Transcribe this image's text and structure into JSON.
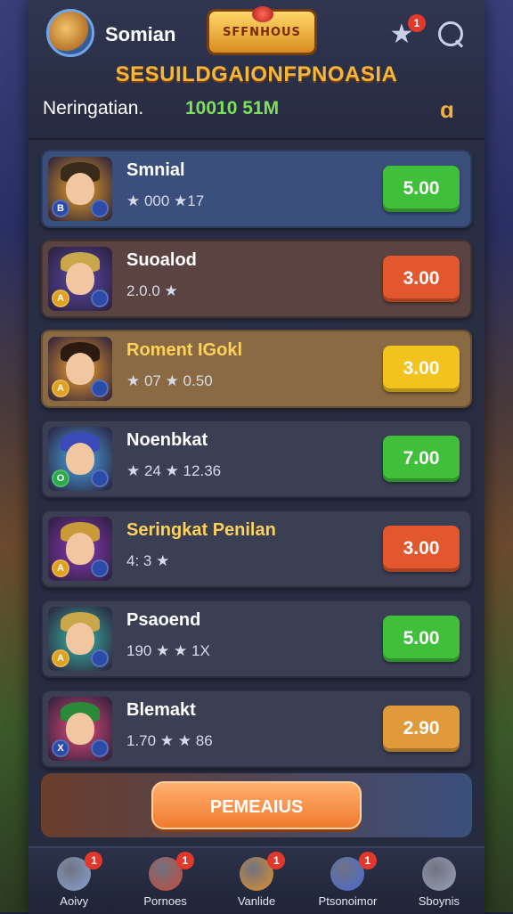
{
  "header": {
    "player_name": "Somian",
    "logo_text": "SFFNHOUS",
    "title": "SESUILDGAIONFPNOASIA",
    "notification_count": "1",
    "balance_label": "Neringatian.",
    "balance_value": "10010 51M"
  },
  "heroes": [
    {
      "name": "Smnial",
      "stats": "★ 000 ★17",
      "price": "5.00",
      "price_color": "#3fbf3a",
      "card_bg": "#3a4f7c",
      "name_color": "#ffffff",
      "hair": "#3a2a1a",
      "bg": "#e6a22a",
      "coin1": "#2c4aa8",
      "coin1_text": "B"
    },
    {
      "name": "Suoalod",
      "stats": "2.0.0 ★",
      "price": "3.00",
      "price_color": "#e2572d",
      "card_bg": "#5a4340",
      "name_color": "#ffffff",
      "hair": "#c8a84a",
      "bg": "#5a4aa8",
      "coin1": "#e0a020",
      "coin1_text": "A"
    },
    {
      "name": "Roment IGokl",
      "stats": "★ 07 ★ 0.50",
      "price": "3.00",
      "price_color": "#f2c21f",
      "card_bg": "#8a6a42",
      "name_color": "#ffd15a",
      "hair": "#2a1a10",
      "bg": "#f0a030",
      "coin1": "#e0a020",
      "coin1_text": "A"
    },
    {
      "name": "Noenbkat",
      "stats": "★ 24 ★ 12.36",
      "price": "7.00",
      "price_color": "#3fbf3a",
      "card_bg": "#3a3f54",
      "name_color": "#ffffff",
      "hair": "#3a4ab8",
      "bg": "#4aa8e8",
      "coin1": "#2aa84a",
      "coin1_text": "O"
    },
    {
      "name": "Seringkat Penilan",
      "stats": "4: 3 ★",
      "price": "3.00",
      "price_color": "#e2572d",
      "card_bg": "#3a3f54",
      "name_color": "#ffd15a",
      "hair": "#c89a3a",
      "bg": "#8a3ab8",
      "coin1": "#e0a020",
      "coin1_text": "A"
    },
    {
      "name": "Psaoend",
      "stats": "190 ★ ★ 1X",
      "price": "5.00",
      "price_color": "#3fbf3a",
      "card_bg": "#3a3f54",
      "name_color": "#ffffff",
      "hair": "#c8a84a",
      "bg": "#3ab8a8",
      "coin1": "#e0a020",
      "coin1_text": "A"
    },
    {
      "name": "Blemakt",
      "stats": "1.70 ★ ★ 86",
      "price": "2.90",
      "price_color": "#e09a3a",
      "card_bg": "#3a3f54",
      "name_color": "#ffffff",
      "hair": "#2a8a3a",
      "bg": "#e04a7a",
      "coin1": "#2c4aa8",
      "coin1_text": "X"
    }
  ],
  "cta_label": "PEMEAIUS",
  "nav": [
    {
      "label": "Aoivy",
      "badge": "1",
      "color": "#8aa2d0"
    },
    {
      "label": "Pornoes",
      "badge": "1",
      "color": "#c84a3a"
    },
    {
      "label": "Vanlide",
      "badge": "1",
      "color": "#e0902a"
    },
    {
      "label": "Ptsonoimor",
      "badge": "1",
      "color": "#4a6ad8"
    },
    {
      "label": "Sboynis",
      "badge": "",
      "color": "#9aa2b8"
    }
  ]
}
